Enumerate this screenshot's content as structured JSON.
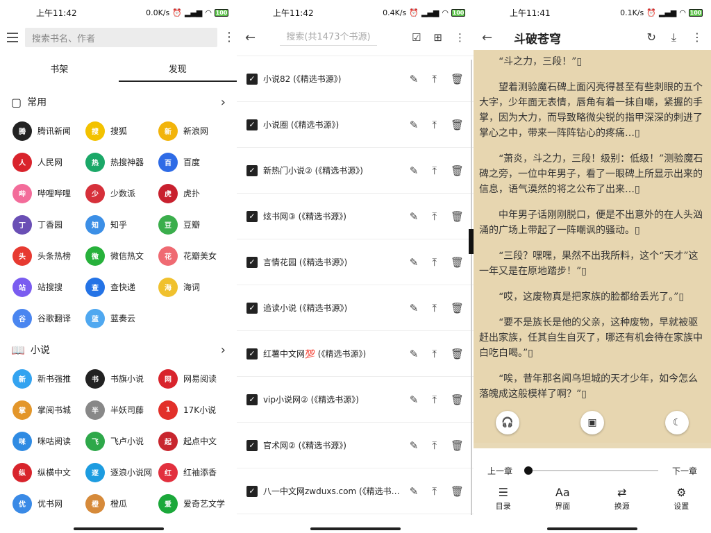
{
  "left": {
    "status": {
      "time": "上午11:42",
      "speed": "0.0K/s",
      "battery": "100"
    },
    "search_placeholder": "搜索书名、作者",
    "tabs": [
      {
        "label": "书架",
        "active": false
      },
      {
        "label": "发现",
        "active": true
      }
    ],
    "sections": [
      {
        "title": "常用",
        "icon": "document-icon",
        "items": [
          {
            "label": "腾讯新闻",
            "color": "#222"
          },
          {
            "label": "搜狐",
            "color": "#f3c200"
          },
          {
            "label": "新浪网",
            "color": "#f2b40b"
          },
          {
            "label": "人民网",
            "color": "#d9232c"
          },
          {
            "label": "热搜神器",
            "color": "#1ba868"
          },
          {
            "label": "百度",
            "color": "#2e6be6"
          },
          {
            "label": "哔哩哔哩",
            "color": "#f36c9a"
          },
          {
            "label": "少数派",
            "color": "#d6303a"
          },
          {
            "label": "虎扑",
            "color": "#c8202e"
          },
          {
            "label": "丁香园",
            "color": "#6a4fb5"
          },
          {
            "label": "知乎",
            "color": "#3c8fe6"
          },
          {
            "label": "豆瓣",
            "color": "#3bae4c"
          },
          {
            "label": "头条热榜",
            "color": "#e73a31"
          },
          {
            "label": "微信热文",
            "color": "#27b13b"
          },
          {
            "label": "花瓣美女",
            "color": "#ef6a72"
          },
          {
            "label": "站搜搜",
            "color": "#7a5cf0"
          },
          {
            "label": "查快递",
            "color": "#2473e6"
          },
          {
            "label": "海词",
            "color": "#f0c12e"
          },
          {
            "label": "谷歌翻译",
            "color": "#4a86f0"
          },
          {
            "label": "蓝奏云",
            "color": "#4fa8f0"
          }
        ]
      },
      {
        "title": "小说",
        "icon": "book-icon",
        "items": [
          {
            "label": "新书强推",
            "color": "#33a3f0"
          },
          {
            "label": "书旗小说",
            "color": "#222"
          },
          {
            "label": "网易阅读",
            "color": "#d8242c"
          },
          {
            "label": "掌阅书城",
            "color": "#e3962a"
          },
          {
            "label": "半妖司藤",
            "color": "#888"
          },
          {
            "label": "17K小说",
            "color": "#e2302a"
          },
          {
            "label": "咪咕阅读",
            "color": "#2f8be3"
          },
          {
            "label": "飞卢小说",
            "color": "#2ea84a"
          },
          {
            "label": "起点中文",
            "color": "#c8262e"
          },
          {
            "label": "纵横中文",
            "color": "#d8242c"
          },
          {
            "label": "逐浪小说网",
            "color": "#1d9ce0"
          },
          {
            "label": "红袖添香",
            "color": "#e2303e"
          },
          {
            "label": "优书网",
            "color": "#3a8ae6"
          },
          {
            "label": "橙瓜",
            "color": "#d68a3a"
          },
          {
            "label": "爱奇艺文学",
            "color": "#1ba83a"
          }
        ]
      }
    ]
  },
  "middle": {
    "status": {
      "time": "上午11:42",
      "speed": "0.4K/s",
      "battery": "100"
    },
    "search_placeholder": "搜索(共1473个书源)",
    "rows": [
      "小说82 (《精选书源》)",
      "小说圈 (《精选书源》)",
      "新热门小说② (《精选书源》)",
      "炫书网③ (《精选书源》)",
      "言情花园 (《精选书源》)",
      "追读小说 (《精选书源》)",
      "红薯中文网💯 (《精选书源》)",
      "vip小说网② (《精选书源》)",
      "官术网② (《精选书源》)",
      "八一中文网zwduxs.com (《精选书源》)"
    ]
  },
  "right": {
    "status": {
      "time": "上午11:41",
      "speed": "0.1K/s",
      "battery": "100"
    },
    "title": "斗破苍穹",
    "paragraphs": [
      "“斗之力，三段！”▯",
      "望着测验魔石碑上面闪亮得甚至有些刺眼的五个大字，少年面无表情，唇角有着一抹自嘲，紧握的手掌，因为大力，而导致略微尖锐的指甲深深的刺进了掌心之中，带来一阵阵钻心的疼痛…▯",
      "“萧炎，斗之力，三段！级别：低级！”测验魔石碑之旁，一位中年男子，看了一眼碑上所显示出来的信息，语气漠然的将之公布了出来…▯",
      "中年男子话刚刚脱口，便是不出意外的在人头汹涌的广场上带起了一阵嘲讽的骚动。▯",
      "“三段？嘿嘿，果然不出我所料，这个“天才”这一年又是在原地踏步！”▯",
      "“哎，这废物真是把家族的脸都给丢光了。”▯",
      "“要不是族长是他的父亲，这种废物，早就被驱赶出家族，任其自生自灭了，哪还有机会待在家族中白吃白喝。”▯",
      "“唉，昔年那名闻乌坦城的天才少年，如今怎么落魄成这般模样了啊？”▯"
    ],
    "prev_chapter": "上一章",
    "next_chapter": "下一章",
    "progress": 0,
    "bottom_tabs": [
      {
        "label": "目录",
        "icon": "list-icon",
        "glyph": "☰"
      },
      {
        "label": "界面",
        "icon": "font-icon",
        "glyph": "Aa"
      },
      {
        "label": "换源",
        "icon": "shuffle-icon",
        "glyph": "⇄"
      },
      {
        "label": "设置",
        "icon": "settings-icon",
        "glyph": "⚙"
      }
    ]
  }
}
